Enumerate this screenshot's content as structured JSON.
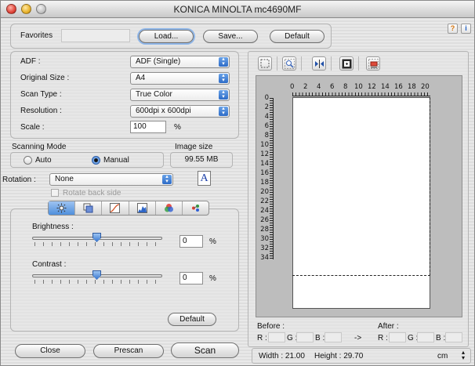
{
  "window": {
    "title": "KONICA MINOLTA mc4690MF"
  },
  "favorites": {
    "label": "Favorites",
    "load": "Load...",
    "save": "Save...",
    "default": "Default"
  },
  "help": {
    "question": "?",
    "info": "i"
  },
  "settings": {
    "adf": {
      "label": "ADF :",
      "value": "ADF (Single)"
    },
    "original_size": {
      "label": "Original Size :",
      "value": "A4"
    },
    "scan_type": {
      "label": "Scan Type :",
      "value": "True Color"
    },
    "resolution": {
      "label": "Resolution :",
      "value": "600dpi x 600dpi"
    },
    "scale": {
      "label": "Scale :",
      "value": "100",
      "unit": "%"
    }
  },
  "scanning_mode": {
    "label": "Scanning Mode",
    "auto": "Auto",
    "manual": "Manual",
    "selected": "Manual"
  },
  "image_size": {
    "label": "Image size",
    "value": "99.55 MB"
  },
  "rotation": {
    "label": "Rotation :",
    "value": "None",
    "icon_letter": "A",
    "rotate_back_side": "Rotate back side"
  },
  "adjust": {
    "brightness": {
      "label": "Brightness :",
      "value": "0",
      "unit": "%",
      "level": 0.5
    },
    "contrast": {
      "label": "Contrast :",
      "value": "0",
      "unit": "%",
      "level": 0.5
    },
    "default": "Default"
  },
  "bottom_buttons": {
    "close": "Close",
    "prescan": "Prescan",
    "scan": "Scan"
  },
  "ruler": {
    "h": [
      "0",
      "2",
      "4",
      "6",
      "8",
      "10",
      "12",
      "14",
      "16",
      "18",
      "20"
    ],
    "v": [
      "0",
      "2",
      "4",
      "6",
      "8",
      "10",
      "12",
      "14",
      "16",
      "18",
      "20",
      "22",
      "24",
      "26",
      "28",
      "30",
      "32",
      "34"
    ]
  },
  "color_info": {
    "before": "Before :",
    "after": "After :",
    "r": "R :",
    "g": "G :",
    "b": "B :",
    "arrow": "->"
  },
  "dimensions": {
    "width": "Width : 21.00",
    "height": "Height : 29.70",
    "unit": "cm"
  },
  "colors": {
    "accent": "#3f7fd7",
    "tab_active": "#4f8fdc"
  }
}
